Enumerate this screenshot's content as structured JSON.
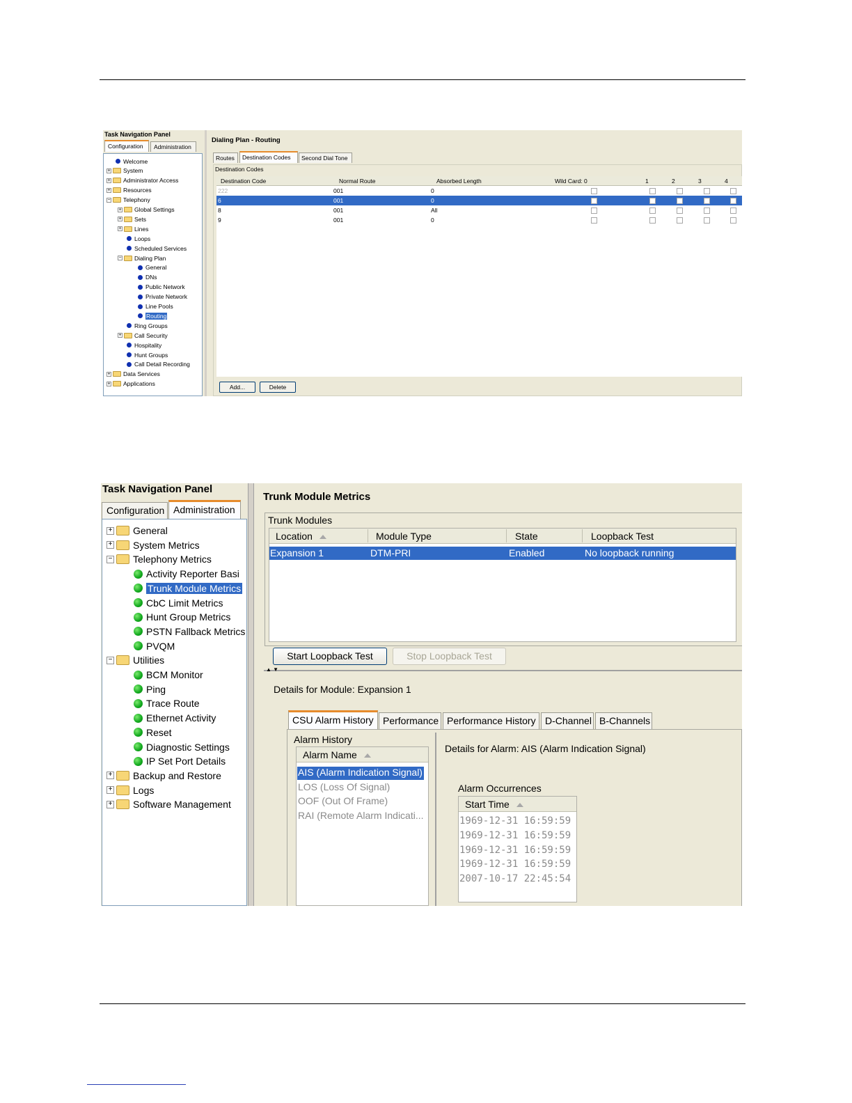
{
  "shot1": {
    "nav_title": "Task Navigation Panel",
    "tabs": [
      "Configuration",
      "Administration"
    ],
    "tree": [
      {
        "label": "Welcome",
        "type": "leaf",
        "level": 0
      },
      {
        "label": "System",
        "type": "folder",
        "level": 0
      },
      {
        "label": "Administrator Access",
        "type": "folder",
        "level": 0
      },
      {
        "label": "Resources",
        "type": "folder",
        "level": 0
      },
      {
        "label": "Telephony",
        "type": "folder-open",
        "level": 0
      },
      {
        "label": "Global Settings",
        "type": "folder",
        "level": 1
      },
      {
        "label": "Sets",
        "type": "folder",
        "level": 1
      },
      {
        "label": "Lines",
        "type": "folder",
        "level": 1
      },
      {
        "label": "Loops",
        "type": "leaf",
        "level": 1
      },
      {
        "label": "Scheduled Services",
        "type": "leaf",
        "level": 1
      },
      {
        "label": "Dialing Plan",
        "type": "folder-open",
        "level": 1
      },
      {
        "label": "General",
        "type": "leaf",
        "level": 2
      },
      {
        "label": "DNs",
        "type": "leaf",
        "level": 2
      },
      {
        "label": "Public Network",
        "type": "leaf",
        "level": 2
      },
      {
        "label": "Private Network",
        "type": "leaf",
        "level": 2
      },
      {
        "label": "Line Pools",
        "type": "leaf",
        "level": 2
      },
      {
        "label": "Routing",
        "type": "leaf",
        "level": 2,
        "selected": true
      },
      {
        "label": "Ring Groups",
        "type": "leaf",
        "level": 1
      },
      {
        "label": "Call Security",
        "type": "folder",
        "level": 1
      },
      {
        "label": "Hospitality",
        "type": "leaf",
        "level": 1
      },
      {
        "label": "Hunt Groups",
        "type": "leaf",
        "level": 1
      },
      {
        "label": "Call Detail Recording",
        "type": "leaf",
        "level": 1
      },
      {
        "label": "Data Services",
        "type": "folder",
        "level": 0
      },
      {
        "label": "Applications",
        "type": "folder",
        "level": 0
      }
    ],
    "page_title": "Dialing Plan - Routing",
    "content_tabs": [
      "Routes",
      "Destination Codes",
      "Second Dial Tone"
    ],
    "group_label": "Destination Codes",
    "columns": [
      "Destination Code",
      "Normal Route",
      "Absorbed Length",
      "Wild Card: 0",
      "1",
      "2",
      "3",
      "4"
    ],
    "rows": [
      {
        "code": "222",
        "route": "001",
        "absorbed": "0",
        "selected": false,
        "dim": true
      },
      {
        "code": "6",
        "route": "001",
        "absorbed": "0",
        "selected": true,
        "dim": false
      },
      {
        "code": "8",
        "route": "001",
        "absorbed": "All",
        "selected": false,
        "dim": false
      },
      {
        "code": "9",
        "route": "001",
        "absorbed": "0",
        "selected": false,
        "dim": false
      }
    ],
    "buttons": {
      "add": "Add...",
      "delete": "Delete"
    }
  },
  "shot2": {
    "nav_title": "Task Navigation Panel",
    "tabs": [
      "Configuration",
      "Administration"
    ],
    "tree": [
      {
        "label": "General",
        "type": "folder",
        "level": 0
      },
      {
        "label": "System Metrics",
        "type": "folder",
        "level": 0
      },
      {
        "label": "Telephony Metrics",
        "type": "folder-open",
        "level": 0
      },
      {
        "label": "Activity Reporter Basi",
        "type": "leaf",
        "level": 1
      },
      {
        "label": "Trunk Module Metrics",
        "type": "leaf",
        "level": 1,
        "selected": true
      },
      {
        "label": "CbC Limit Metrics",
        "type": "leaf",
        "level": 1
      },
      {
        "label": "Hunt Group Metrics",
        "type": "leaf",
        "level": 1
      },
      {
        "label": "PSTN Fallback Metrics",
        "type": "leaf",
        "level": 1
      },
      {
        "label": "PVQM",
        "type": "leaf",
        "level": 1
      },
      {
        "label": "Utilities",
        "type": "folder-open",
        "level": 0
      },
      {
        "label": "BCM Monitor",
        "type": "leaf",
        "level": 1
      },
      {
        "label": "Ping",
        "type": "leaf",
        "level": 1
      },
      {
        "label": "Trace Route",
        "type": "leaf",
        "level": 1
      },
      {
        "label": "Ethernet Activity",
        "type": "leaf",
        "level": 1
      },
      {
        "label": "Reset",
        "type": "leaf",
        "level": 1
      },
      {
        "label": "Diagnostic Settings",
        "type": "leaf",
        "level": 1
      },
      {
        "label": "IP Set Port Details",
        "type": "leaf",
        "level": 1
      },
      {
        "label": "Backup and Restore",
        "type": "folder",
        "level": 0
      },
      {
        "label": "Logs",
        "type": "folder",
        "level": 0
      },
      {
        "label": "Software Management",
        "type": "folder",
        "level": 0
      }
    ],
    "page_title": "Trunk Module Metrics",
    "group_label": "Trunk Modules",
    "columns": [
      "Location",
      "Module Type",
      "State",
      "Loopback Test"
    ],
    "row": {
      "location": "Expansion 1",
      "module_type": "DTM-PRI",
      "state": "Enabled",
      "loopback": "No loopback running"
    },
    "buttons": {
      "start": "Start Loopback Test",
      "stop": "Stop Loopback Test"
    },
    "details_title": "Details for Module: Expansion 1",
    "detail_tabs": [
      "CSU Alarm History",
      "Performance",
      "Performance History",
      "D-Channel",
      "B-Channels"
    ],
    "alarm_history_label": "Alarm History",
    "alarm_column": "Alarm Name",
    "alarms": [
      {
        "label": "AIS (Alarm Indication Signal)",
        "selected": true
      },
      {
        "label": "LOS (Loss Of Signal)",
        "selected": false
      },
      {
        "label": "OOF (Out Of Frame)",
        "selected": false
      },
      {
        "label": "RAI (Remote Alarm Indicati...",
        "selected": false
      }
    ],
    "alarm_detail_title": "Details for Alarm: AIS (Alarm Indication Signal)",
    "occurrences_label": "Alarm Occurrences",
    "occurrences_column": "Start Time",
    "occurrences": [
      "1969-12-31 16:59:59",
      "1969-12-31 16:59:59",
      "1969-12-31 16:59:59",
      "1969-12-31 16:59:59",
      "2007-10-17 22:45:54"
    ]
  }
}
